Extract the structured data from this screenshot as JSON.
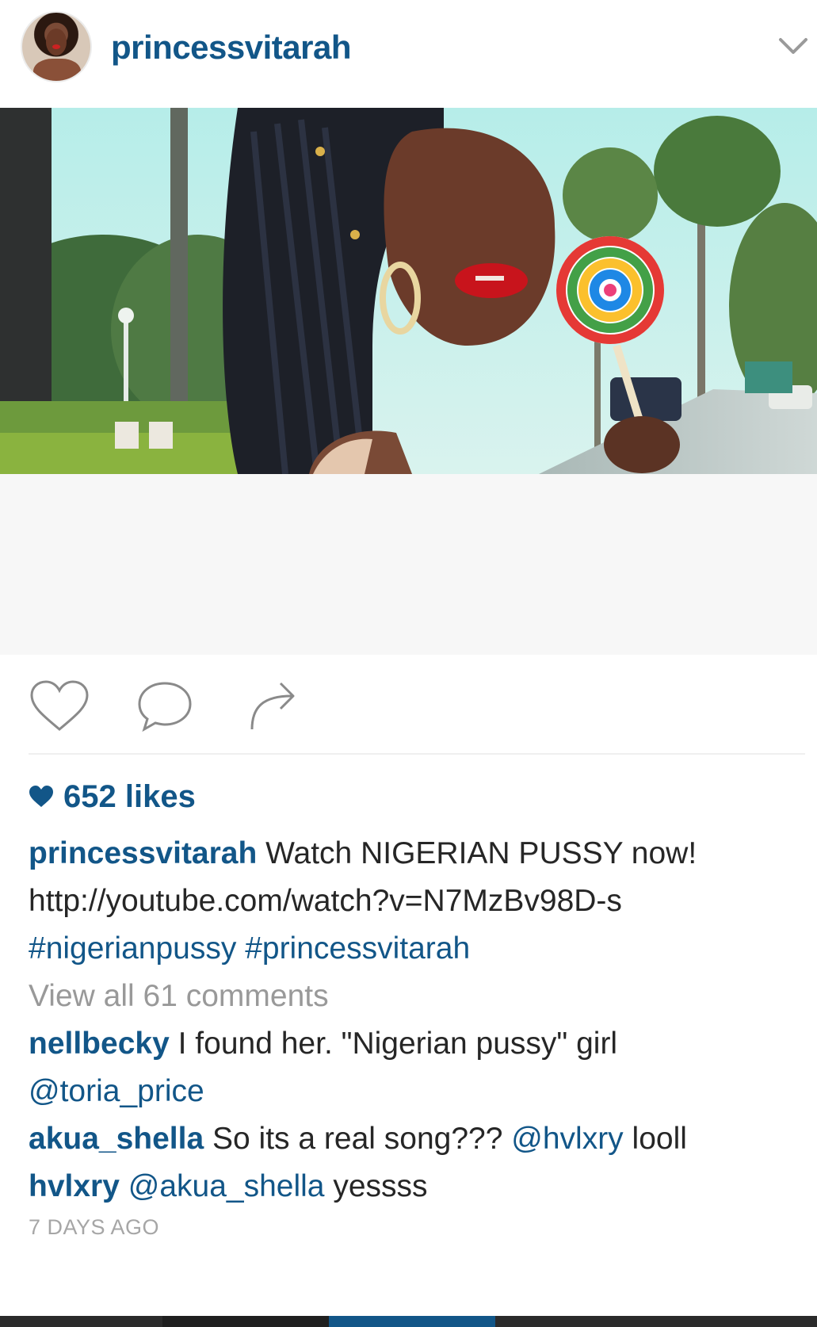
{
  "post": {
    "username": "princessvitarah",
    "likes": "652 likes",
    "caption": {
      "username": "princessvitarah",
      "text": "Watch NIGERIAN PUSSY now! http://youtube.com/watch?v=N7MzBv98D-s",
      "hashtag1": "#nigerianpussy",
      "hashtag2": "#princessvitarah"
    },
    "view_all": "View all 61 comments",
    "comments": [
      {
        "user": "nellbecky",
        "text": "I found her. \"Nigerian pussy\" girl",
        "mention": "@toria_price",
        "after": ""
      },
      {
        "user": "akua_shella",
        "text": "So its a real song???",
        "mention": "@hvlxry",
        "after": "looll"
      },
      {
        "user": "hvlxry",
        "text": "",
        "mention": "@akua_shella",
        "after": "yessss"
      }
    ],
    "timestamp": "7 DAYS AGO"
  },
  "icons": {
    "header_menu": "chevron-down-icon",
    "like": "heart-outline-icon",
    "comment": "comment-bubble-icon",
    "share": "share-arrow-icon",
    "likes_badge": "heart-filled-icon"
  },
  "colors": {
    "link": "#125688",
    "text": "#262626",
    "muted": "#999999",
    "tab_active": "#125688",
    "tab_bar": "#2b2b2b"
  }
}
